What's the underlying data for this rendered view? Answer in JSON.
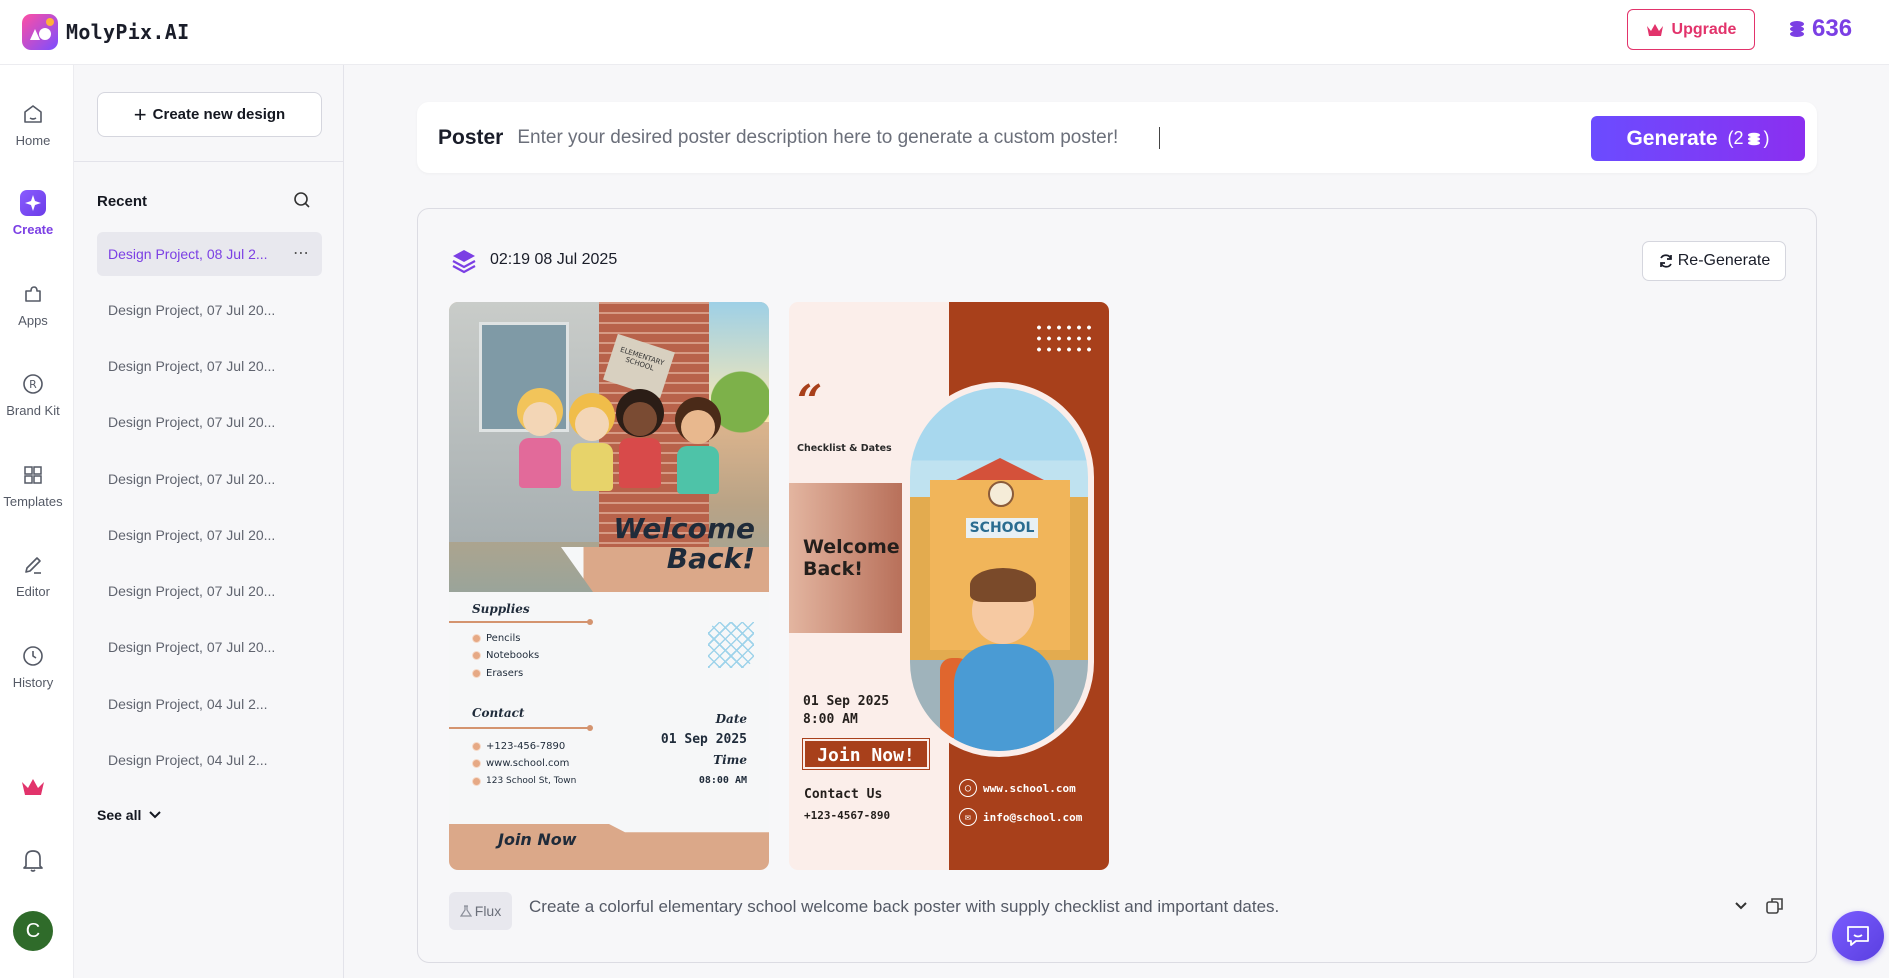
{
  "app": {
    "brand": "MolyPix.AI",
    "upgrade_label": "Upgrade",
    "credits": "636",
    "colors": {
      "accent": "#7b3fe4",
      "upgrade": "#e2336b",
      "generate_start": "#6b4cff",
      "generate_end": "#8b2ff0"
    }
  },
  "rail": {
    "items": [
      {
        "label": "Home",
        "icon": "home-icon"
      },
      {
        "label": "Create",
        "icon": "sparkle-icon",
        "active": true
      },
      {
        "label": "Apps",
        "icon": "puzzle-icon"
      },
      {
        "label": "Brand Kit",
        "icon": "registered-icon"
      },
      {
        "label": "Templates",
        "icon": "grid-icon"
      },
      {
        "label": "Editor",
        "icon": "pencil-icon"
      },
      {
        "label": "History",
        "icon": "clock-icon"
      }
    ],
    "bottom": {
      "premium_icon": "crown-icon",
      "notifications_icon": "bell-icon",
      "avatar_letter": "C"
    }
  },
  "sidebar": {
    "create_label": "Create new design",
    "recent_title": "Recent",
    "projects": [
      "Design Project, 08 Jul 2...",
      "Design Project, 07 Jul 20...",
      "Design Project, 07 Jul 20...",
      "Design Project, 07 Jul 20...",
      "Design Project, 07 Jul 20...",
      "Design Project, 07 Jul 20...",
      "Design Project, 07 Jul 20...",
      "Design Project, 07 Jul 20...",
      "Design Project, 04 Jul 2...",
      "Design Project, 04 Jul 2..."
    ],
    "see_all_label": "See all"
  },
  "prompt": {
    "label": "Poster",
    "placeholder": "Enter your desired poster description here to generate a custom poster!",
    "generate_label": "Generate",
    "generate_cost": "2"
  },
  "result": {
    "timestamp": "02:19 08 Jul 2025",
    "regenerate_label": "Re-Generate",
    "model": "Flux",
    "prompt_text": "Create a colorful elementary school welcome back poster with supply checklist and important dates.",
    "poster1": {
      "building_sign": "ELEMENTARY SCHOOL",
      "welcome_line1": "Welcome",
      "welcome_line2": "Back!",
      "supplies_title": "Supplies",
      "supplies": [
        "Pencils",
        "Notebooks",
        "Erasers"
      ],
      "contact_title": "Contact",
      "contacts": [
        "+123-456-7890",
        "www.school.com",
        "123 School St, Town"
      ],
      "date_label": "Date",
      "date_value": "01 Sep 2025",
      "time_label": "Time",
      "time_value": "08:00 AM",
      "join_label": "Join Now"
    },
    "poster2": {
      "quote_mark": "“",
      "checklist_label": "Checklist & Dates",
      "welcome_line1": "Welcome",
      "welcome_line2": "Back!",
      "school_sign": "SCHOOL",
      "date_line": "01 Sep 2025",
      "time_line": "8:00 AM",
      "join_label": "Join Now!",
      "contact_title": "Contact Us",
      "phone": "+123-4567-890",
      "website": "www.school.com",
      "email": "info@school.com"
    }
  }
}
